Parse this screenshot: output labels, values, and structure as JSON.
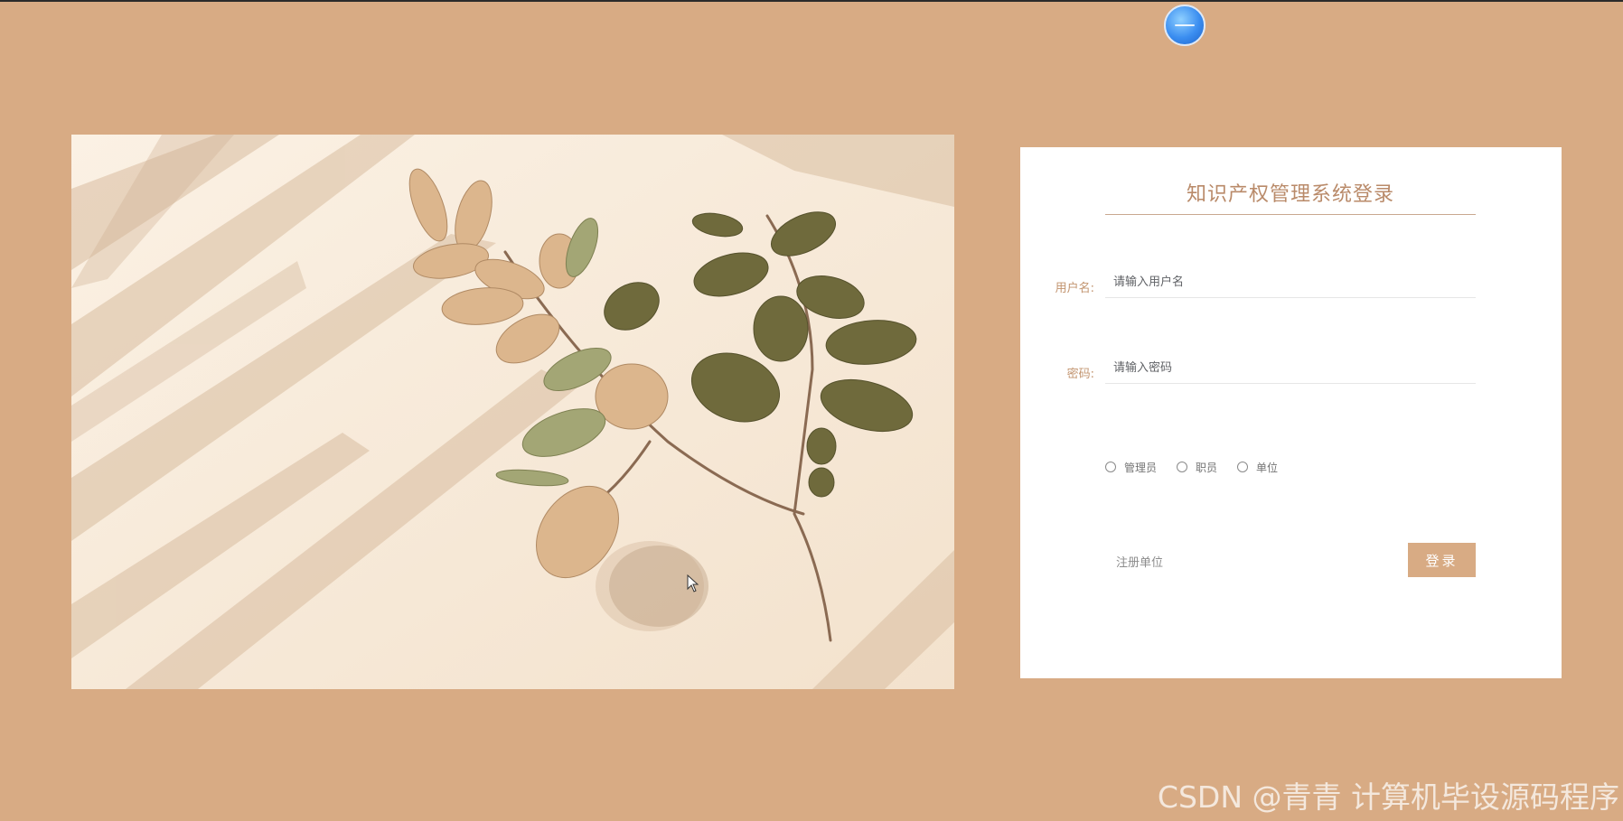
{
  "login": {
    "title": "知识产权管理系统登录",
    "username": {
      "label": "用户名:",
      "placeholder": "请输入用户名",
      "value": ""
    },
    "password": {
      "label": "密码:",
      "placeholder": "请输入密码",
      "value": ""
    },
    "roles": [
      {
        "label": "管理员",
        "selected": false
      },
      {
        "label": "职员",
        "selected": false
      },
      {
        "label": "单位",
        "selected": false
      }
    ],
    "register_link": "注册单位",
    "login_button": "登录"
  },
  "watermark": "CSDN @青青  计算机毕设源码程序",
  "colors": {
    "page_background": "#d8ab84",
    "accent": "#b98a69",
    "button": "#d8ab84",
    "card": "#ffffff"
  },
  "icons": {
    "avatar": "avatar-icon",
    "cursor": "mouse-pointer-icon"
  }
}
